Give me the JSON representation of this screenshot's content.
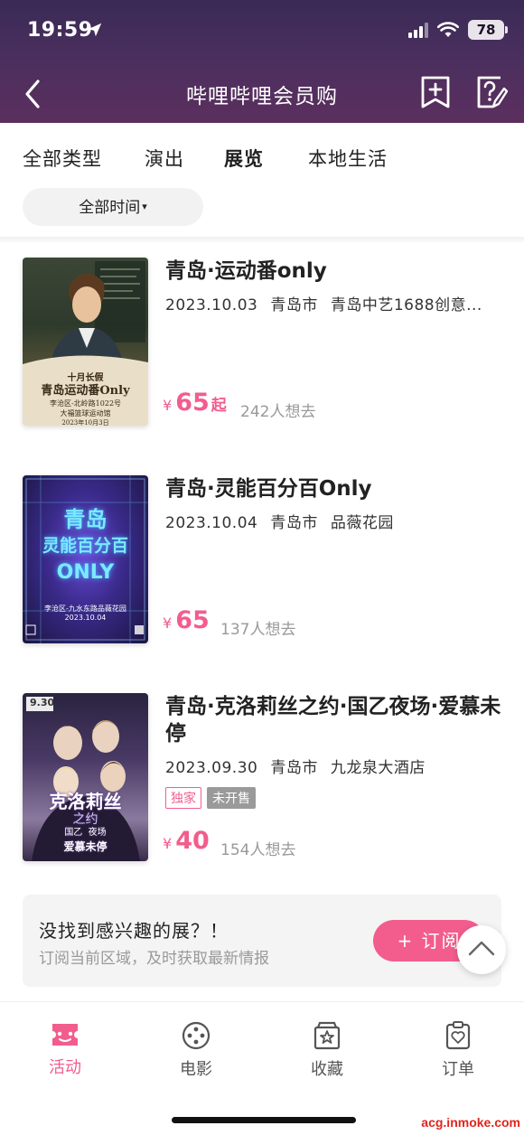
{
  "status_bar": {
    "time": "19:59",
    "battery": "78"
  },
  "nav": {
    "title": "哔哩哔哩会员购",
    "icons": [
      "back-icon",
      "bookmark-add-icon",
      "feedback-icon"
    ]
  },
  "tabs": [
    {
      "label": "全部类型",
      "active": false
    },
    {
      "label": "演出",
      "active": false
    },
    {
      "label": "展览",
      "active": true
    },
    {
      "label": "本地生活",
      "active": false
    }
  ],
  "time_filter": {
    "label": "全部时间"
  },
  "events": [
    {
      "title": "青岛·运动番only",
      "date": "2023.10.03",
      "city": "青岛市",
      "venue": "青岛中艺1688创意...",
      "price": "65",
      "price_suffix": "起",
      "want": "242人想去",
      "poster": {
        "line1": "十月长假",
        "line2": "青岛运动番Only",
        "line3": "李沧区-北岭路1022号",
        "line4": "大福篮球运动馆",
        "line5": "2023年10月3日"
      }
    },
    {
      "title": "青岛·灵能百分百Only",
      "date": "2023.10.04",
      "city": "青岛市",
      "venue": "品薇花园",
      "price": "65",
      "want": "137人想去",
      "poster": {
        "line1": "青岛",
        "line2": "灵能百分百",
        "line3": "ONLY",
        "line4": "李沧区-九水东路品薇花园",
        "line5": "2023.10.04"
      }
    },
    {
      "title": "青岛·克洛莉丝之约·国乙夜场·爱慕未停",
      "date": "2023.09.30",
      "city": "青岛市",
      "venue": "九龙泉大酒店",
      "tags": [
        "独家",
        "未开售"
      ],
      "price": "40",
      "want": "154人想去",
      "poster": {
        "line1": "9.30",
        "line2": "克洛莉丝",
        "line3": "之约",
        "line4": "国乙",
        "line5": "夜场",
        "line6": "爱慕未停"
      }
    }
  ],
  "subscribe": {
    "title": "没找到感兴趣的展？！",
    "desc": "订阅当前区域，及时获取最新情报",
    "button": "+ 订阅"
  },
  "bottom_nav": [
    {
      "label": "活动",
      "icon": "ticket-icon",
      "active": true
    },
    {
      "label": "电影",
      "icon": "film-reel-icon",
      "active": false
    },
    {
      "label": "收藏",
      "icon": "star-box-icon",
      "active": false
    },
    {
      "label": "订单",
      "icon": "order-heart-icon",
      "active": false
    }
  ],
  "watermark": "acg.inmoke.com",
  "colors": {
    "accent": "#f25d8e",
    "header_top": "#3a2a55",
    "header_bottom": "#5b2f5e"
  }
}
